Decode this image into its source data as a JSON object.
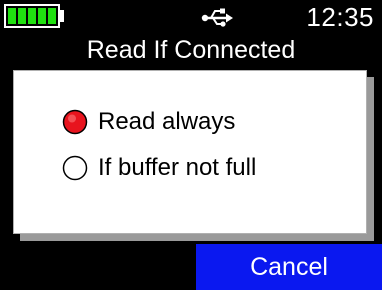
{
  "status_bar": {
    "battery_icon": "battery-full-icon",
    "battery_color": "#20e010",
    "battery_level": 1.0,
    "usb_icon": "usb-icon",
    "clock": "12:35"
  },
  "screen": {
    "title": "Read If Connected"
  },
  "dialog": {
    "options": [
      {
        "label": "Read always",
        "selected": true
      },
      {
        "label": "If buffer not full",
        "selected": false
      }
    ],
    "selected_color": "#e8141e"
  },
  "softkeys": {
    "right_label": "Cancel",
    "right_color": "#0a18f0"
  }
}
